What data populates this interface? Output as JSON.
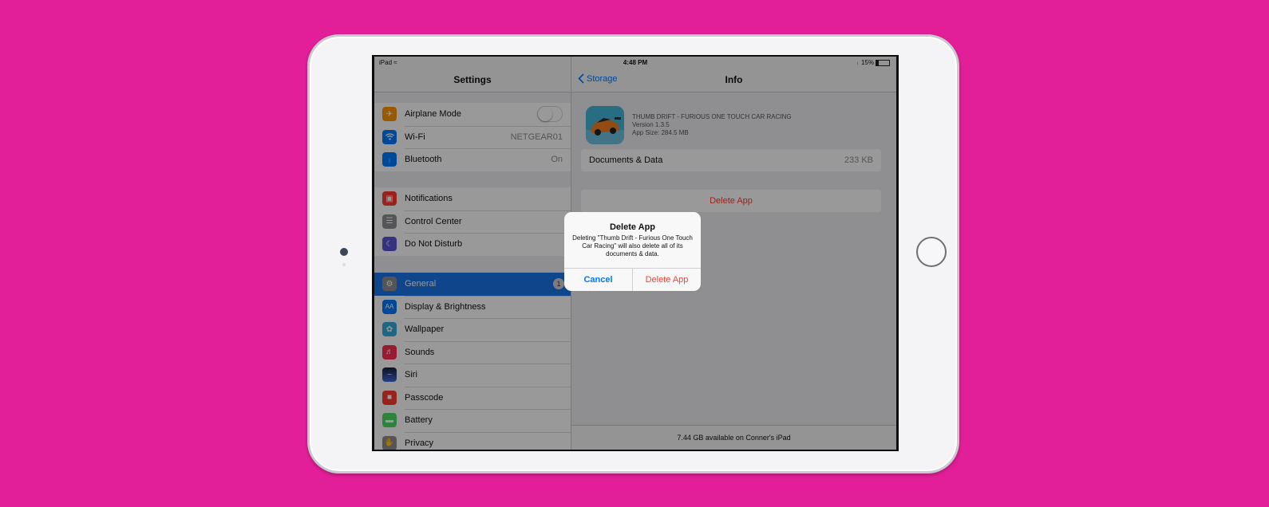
{
  "status_bar": {
    "device": "iPad",
    "time": "4:48 PM",
    "battery": "15%"
  },
  "settings": {
    "title": "Settings",
    "group1": [
      {
        "label": "Airplane Mode",
        "icon": "airplane-icon",
        "color": "#ff9500"
      },
      {
        "label": "Wi-Fi",
        "value": "NETGEAR01",
        "icon": "wifi-icon",
        "color": "#007aff"
      },
      {
        "label": "Bluetooth",
        "value": "On",
        "icon": "bluetooth-icon",
        "color": "#007aff"
      }
    ],
    "group2": [
      {
        "label": "Notifications",
        "icon": "notifications-icon",
        "color": "#ff3b30"
      },
      {
        "label": "Control Center",
        "icon": "control-center-icon",
        "color": "#8e8e93"
      },
      {
        "label": "Do Not Disturb",
        "icon": "moon-icon",
        "color": "#5856d6"
      }
    ],
    "group3": [
      {
        "label": "General",
        "badge": "1",
        "icon": "gear-icon",
        "color": "#8e8e93"
      },
      {
        "label": "Display & Brightness",
        "icon": "display-brightness-icon",
        "color": "#007aff"
      },
      {
        "label": "Wallpaper",
        "icon": "wallpaper-icon",
        "color": "#34aadc"
      },
      {
        "label": "Sounds",
        "icon": "speaker-icon",
        "color": "#ff2d55"
      },
      {
        "label": "Siri",
        "icon": "siri-icon",
        "color": "#1c1c3a"
      },
      {
        "label": "Passcode",
        "icon": "lock-icon",
        "color": "#ff3b30"
      },
      {
        "label": "Battery",
        "icon": "battery-icon",
        "color": "#4cd964"
      },
      {
        "label": "Privacy",
        "icon": "hand-icon",
        "color": "#8e8e93"
      }
    ]
  },
  "detail": {
    "back_label": "Storage",
    "title": "Info",
    "app": {
      "name": "THUMB DRIFT - FURIOUS ONE TOUCH CAR RACING",
      "version": "Version 1.3.5",
      "size": "App Size: 284.5 MB"
    },
    "documents_label": "Documents & Data",
    "documents_value": "233 KB",
    "delete_label": "Delete App",
    "footer": "7.44 GB available on Conner's iPad"
  },
  "alert": {
    "title": "Delete App",
    "message": "Deleting \"Thumb Drift - Furious One Touch Car Racing\" will also delete all of its documents & data.",
    "cancel": "Cancel",
    "delete": "Delete App"
  }
}
